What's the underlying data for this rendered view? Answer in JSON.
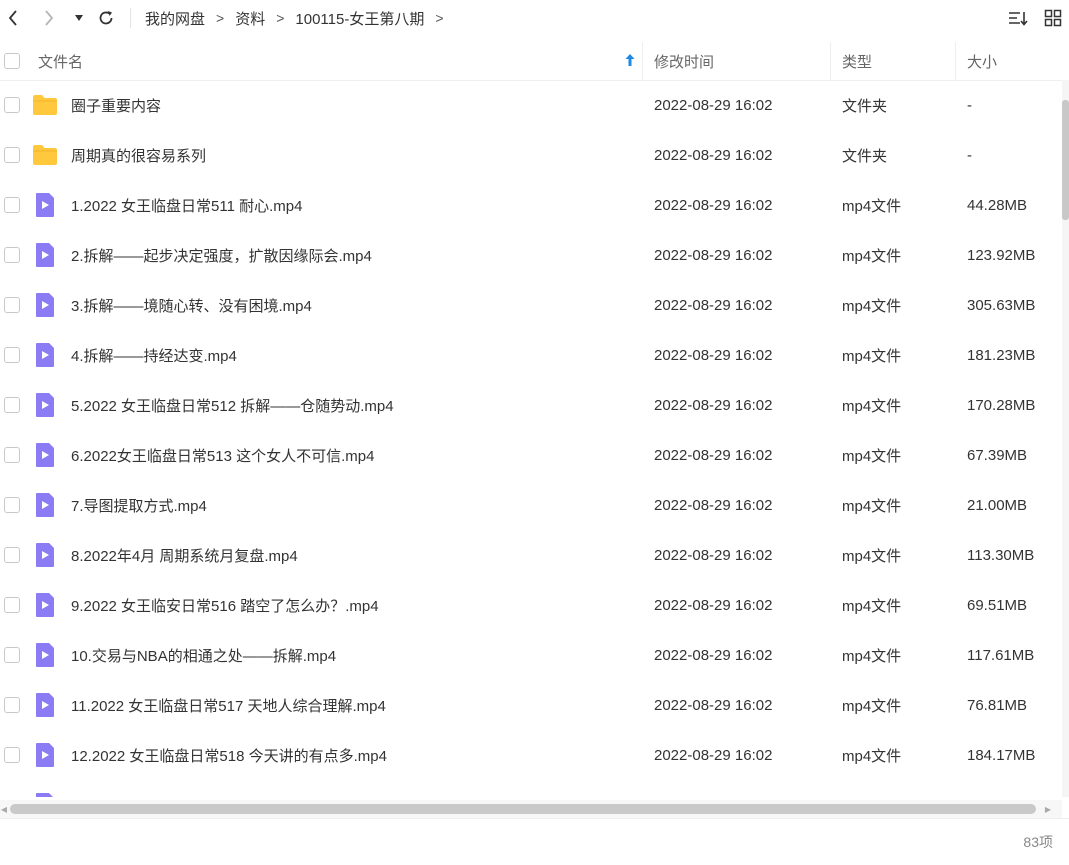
{
  "breadcrumb": {
    "items": [
      "我的网盘",
      "资料",
      "100115-女王第八期"
    ],
    "separator": ">"
  },
  "icons": {
    "back": "chevron-left-icon",
    "forward": "chevron-right-icon",
    "history": "caret-down-icon",
    "refresh": "refresh-icon",
    "sort": "sort-list-icon",
    "grid": "grid-view-icon",
    "folder": "folder-icon",
    "video": "video-file-icon"
  },
  "colors": {
    "folder": "#FFC83D",
    "video": "#8B7CF6",
    "sort_arrow": "#1E88E5"
  },
  "header": {
    "name": "文件名",
    "time": "修改时间",
    "type": "类型",
    "size": "大小"
  },
  "files": [
    {
      "kind": "folder",
      "name": "圈子重要内容",
      "time": "2022-08-29 16:02",
      "type": "文件夹",
      "size": "-"
    },
    {
      "kind": "folder",
      "name": "周期真的很容易系列",
      "time": "2022-08-29 16:02",
      "type": "文件夹",
      "size": "-"
    },
    {
      "kind": "video",
      "name": "1.2022 女王临盘日常511 耐心.mp4",
      "time": "2022-08-29 16:02",
      "type": "mp4文件",
      "size": "44.28MB"
    },
    {
      "kind": "video",
      "name": "2.拆解——起步决定强度，扩散因缘际会.mp4",
      "time": "2022-08-29 16:02",
      "type": "mp4文件",
      "size": "123.92MB"
    },
    {
      "kind": "video",
      "name": "3.拆解——境随心转、没有困境.mp4",
      "time": "2022-08-29 16:02",
      "type": "mp4文件",
      "size": "305.63MB"
    },
    {
      "kind": "video",
      "name": "4.拆解——持经达变.mp4",
      "time": "2022-08-29 16:02",
      "type": "mp4文件",
      "size": "181.23MB"
    },
    {
      "kind": "video",
      "name": "5.2022 女王临盘日常512 拆解——仓随势动.mp4",
      "time": "2022-08-29 16:02",
      "type": "mp4文件",
      "size": "170.28MB"
    },
    {
      "kind": "video",
      "name": "6.2022女王临盘日常513 这个女人不可信.mp4",
      "time": "2022-08-29 16:02",
      "type": "mp4文件",
      "size": "67.39MB"
    },
    {
      "kind": "video",
      "name": "7.导图提取方式.mp4",
      "time": "2022-08-29 16:02",
      "type": "mp4文件",
      "size": "21.00MB"
    },
    {
      "kind": "video",
      "name": "8.2022年4月 周期系统月复盘.mp4",
      "time": "2022-08-29 16:02",
      "type": "mp4文件",
      "size": "113.30MB"
    },
    {
      "kind": "video",
      "name": "9.2022 女王临安日常516 踏空了怎么办？.mp4",
      "time": "2022-08-29 16:02",
      "type": "mp4文件",
      "size": "69.51MB"
    },
    {
      "kind": "video",
      "name": "10.交易与NBA的相通之处——拆解.mp4",
      "time": "2022-08-29 16:02",
      "type": "mp4文件",
      "size": "117.61MB"
    },
    {
      "kind": "video",
      "name": "11.2022 女王临盘日常517 天地人综合理解.mp4",
      "time": "2022-08-29 16:02",
      "type": "mp4文件",
      "size": "76.81MB"
    },
    {
      "kind": "video",
      "name": "12.2022 女王临盘日常518 今天讲的有点多.mp4",
      "time": "2022-08-29 16:02",
      "type": "mp4文件",
      "size": "184.17MB"
    },
    {
      "kind": "video",
      "name": "",
      "time": "",
      "type": "",
      "size": ""
    }
  ],
  "footer": {
    "count": "83项"
  }
}
